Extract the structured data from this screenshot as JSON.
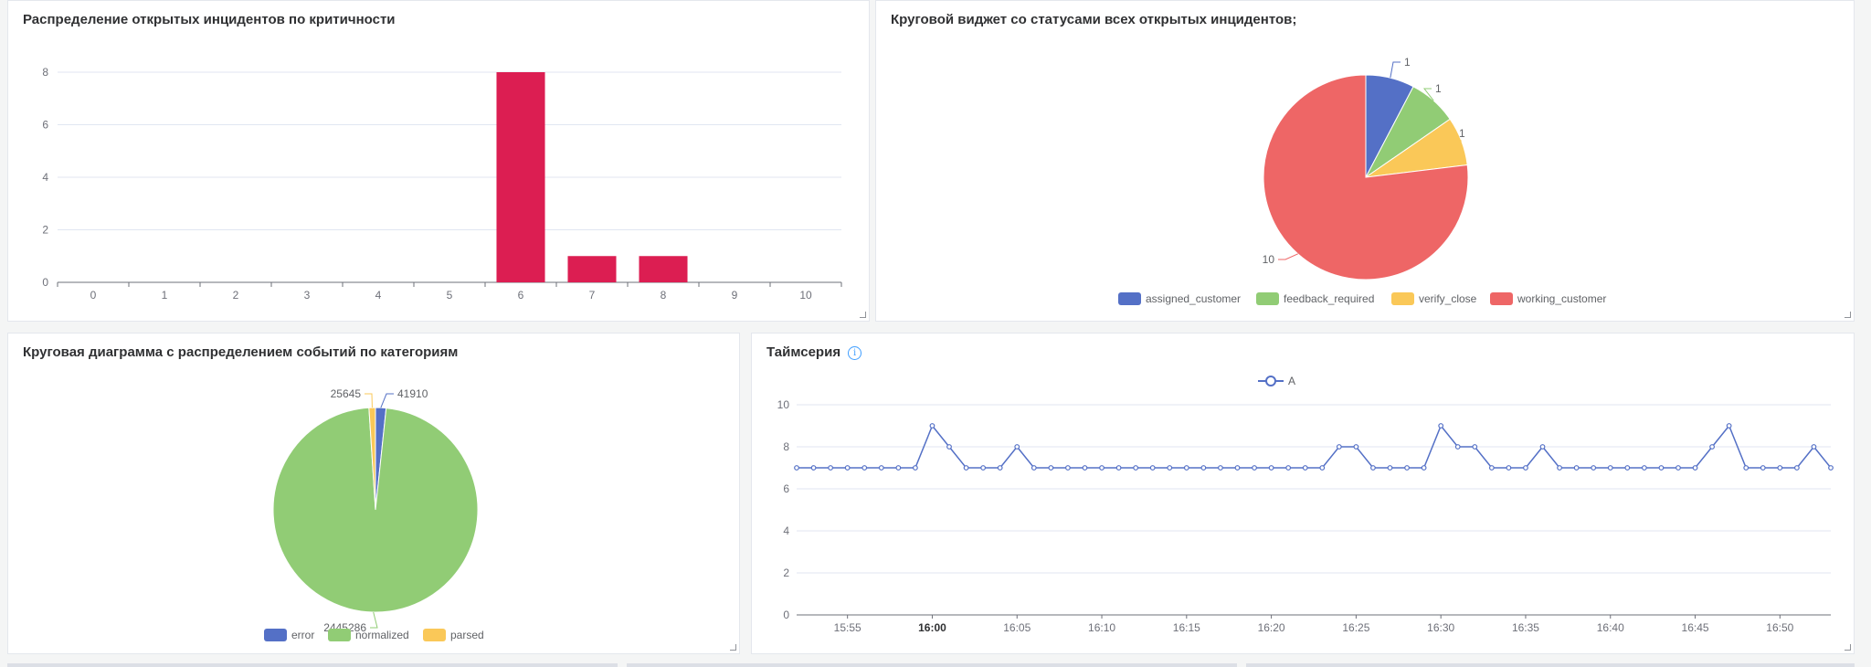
{
  "panels": {
    "severity": {
      "title": "Распределение открытых инцидентов по критичности"
    },
    "status": {
      "title": "Круговой виджет со статусами всех открытых инцидентов;"
    },
    "category": {
      "title": "Круговая диаграмма с распределением событий по категориям"
    },
    "timeseries": {
      "title": "Таймсерия",
      "info_icon": "info-icon"
    }
  },
  "chart_data": [
    {
      "id": "severity",
      "type": "bar",
      "categories": [
        "0",
        "1",
        "2",
        "3",
        "4",
        "5",
        "6",
        "7",
        "8",
        "9",
        "10"
      ],
      "values": [
        0,
        0,
        0,
        0,
        0,
        0,
        8,
        1,
        1,
        0,
        0
      ],
      "ylim": [
        0,
        8
      ],
      "yticks": [
        "0",
        "2",
        "4",
        "6",
        "8"
      ],
      "grid": true,
      "color": "#dc1e52"
    },
    {
      "id": "status",
      "type": "pie",
      "labels": [
        "assigned_customer",
        "feedback_required",
        "verify_close",
        "working_customer"
      ],
      "values": [
        1,
        1,
        1,
        10
      ],
      "value_labels": [
        "1",
        "1",
        "1",
        "10"
      ],
      "colors": [
        "#5470c6",
        "#91cc75",
        "#fac858",
        "#ee6666"
      ],
      "legend": "bottom"
    },
    {
      "id": "category",
      "type": "pie",
      "labels": [
        "error",
        "normalized",
        "parsed"
      ],
      "values": [
        41910,
        2445286,
        25645
      ],
      "value_labels": [
        "41910",
        "2445286",
        "25645"
      ],
      "colors": [
        "#5470c6",
        "#91cc75",
        "#fac858"
      ],
      "legend": "bottom"
    },
    {
      "id": "timeseries",
      "type": "line",
      "series": [
        {
          "name": "A",
          "values": [
            7,
            7,
            7,
            7,
            7,
            7,
            7,
            7,
            9,
            8,
            7,
            7,
            7,
            8,
            7,
            7,
            7,
            7,
            7,
            7,
            7,
            7,
            7,
            7,
            7,
            7,
            7,
            7,
            7,
            7,
            7,
            7,
            8,
            8,
            7,
            7,
            7,
            7,
            9,
            8,
            8,
            7,
            7,
            7,
            8,
            7,
            7,
            7,
            7,
            7,
            7,
            7,
            7,
            7,
            8,
            9,
            7,
            7,
            7,
            7,
            8,
            7
          ],
          "color": "#5470c6"
        }
      ],
      "x_start": "15:52",
      "x_step_minutes": 1,
      "xticks": [
        "15:55",
        "16:00",
        "16:05",
        "16:10",
        "16:15",
        "16:20",
        "16:25",
        "16:30",
        "16:35",
        "16:40",
        "16:45",
        "16:50"
      ],
      "xticks_bold": [
        "16:00"
      ],
      "ylim": [
        0,
        10
      ],
      "yticks": [
        "0",
        "2",
        "4",
        "6",
        "8",
        "10"
      ],
      "grid": true,
      "legend": "top"
    }
  ]
}
